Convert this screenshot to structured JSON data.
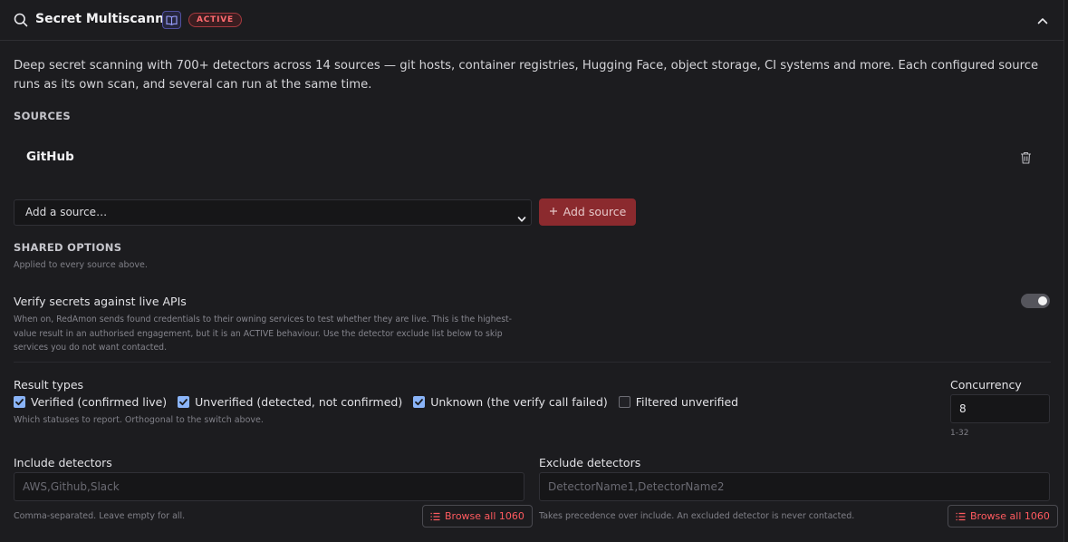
{
  "panel": {
    "title": "Secret Multiscanner",
    "badge": "ACTIVE",
    "description": "Deep secret scanning with 700+ detectors across 14 sources — git hosts, container registries, Hugging Face, object storage, CI systems and more. Each configured source runs as its own scan, and several can run at the same time."
  },
  "sources": {
    "heading": "SOURCES",
    "items": [
      {
        "name": "GitHub"
      }
    ],
    "select_value": "Add a source…",
    "add_button": "Add source"
  },
  "shared": {
    "heading": "SHARED OPTIONS",
    "subtitle": "Applied to every source above.",
    "verify": {
      "label": "Verify secrets against live APIs",
      "help": "When on, RedAmon sends found credentials to their owning services to test whether they are live. This is the highest-value result in an authorised engagement, but it is an ACTIVE behaviour. Use the detector exclude list below to skip services you do not want contacted.",
      "enabled": true
    },
    "result_types": {
      "label": "Result types",
      "options": [
        {
          "label": "Verified (confirmed live)",
          "checked": true
        },
        {
          "label": "Unverified (detected, not confirmed)",
          "checked": true
        },
        {
          "label": "Unknown (the verify call failed)",
          "checked": true
        },
        {
          "label": "Filtered unverified",
          "checked": false
        }
      ],
      "help": "Which statuses to report. Orthogonal to the switch above."
    },
    "concurrency": {
      "label": "Concurrency",
      "value": "8",
      "hint": "1-32"
    },
    "include": {
      "label": "Include detectors",
      "placeholder": "AWS,Github,Slack",
      "help": "Comma-separated. Leave empty for all.",
      "browse": "Browse all 1060"
    },
    "exclude": {
      "label": "Exclude detectors",
      "placeholder": "DetectorName1,DetectorName2",
      "help": "Takes precedence over include. An excluded detector is never contacted.",
      "browse": "Browse all 1060"
    }
  },
  "colors": {
    "accent": "#8b2a2e",
    "badge_text": "#ff6b70",
    "checkbox": "#8ab4f8",
    "link_red": "#ff5a5f"
  },
  "icons": [
    "search-icon",
    "book-icon",
    "chevron-up-icon",
    "trash-icon",
    "chevron-down-icon",
    "plus-icon",
    "list-icon",
    "check-icon"
  ]
}
